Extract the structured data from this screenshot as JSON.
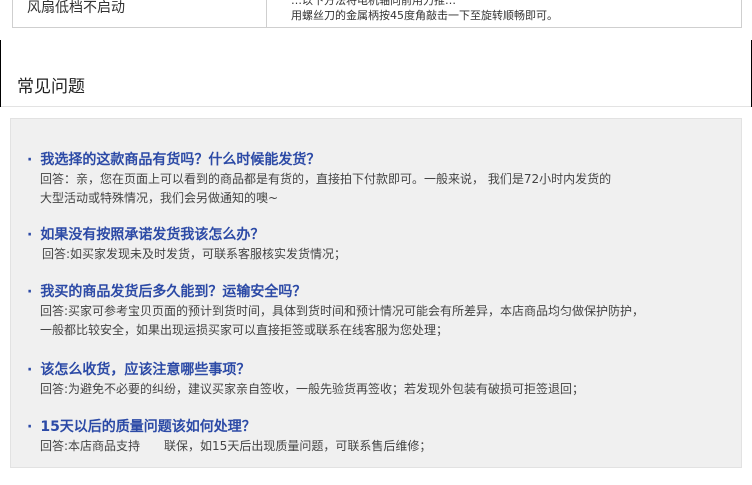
{
  "spec_table": {
    "row_label": "风扇低档不启动",
    "cut_text": "…以下方法将电机轴向前用力推…",
    "row_text": "用螺丝刀的金属柄按45度角敲击一下至旋转顺畅即可。"
  },
  "faq": {
    "title": "常见问题",
    "bullet": "·",
    "items": [
      {
        "question": "我选择的这款商品有货吗？什么时候能发货？",
        "answer_lines": [
          "回答：亲，您在页面上可以看到的商品都是有货的，直接拍下付款即可。一般来说， 我们是72小时内发货的",
          "大型活动或特殊情况，我们会另做通知的噢~"
        ]
      },
      {
        "question": "如果没有按照承诺发货我该怎么办？",
        "answer_lines": [
          "回答:如买家发现未及时发货，可联系客服核实发货情况；"
        ]
      },
      {
        "question": "我买的商品发货后多久能到？运输安全吗？",
        "answer_lines": [
          "回答:买家可参考宝贝页面的预计到货时间，具体到货时间和预计情况可能会有所差异，本店商品均匀做保护防护，",
          "一般都比较安全，如果出现运损买家可以直接拒签或联系在线客服为您处理；"
        ]
      },
      {
        "question": "该怎么收货，应该注意哪些事项？",
        "answer_lines": [
          "回答:为避免不必要的纠纷，建议买家亲自签收，一般先验货再签收；若发现外包装有破损可拒签退回；"
        ]
      },
      {
        "question": "15天以后的质量问题该如何处理？",
        "answer_lines": [
          "回答:本店商品支持　　联保，如15天后出现质量问题，可联系售后维修；"
        ]
      }
    ]
  }
}
